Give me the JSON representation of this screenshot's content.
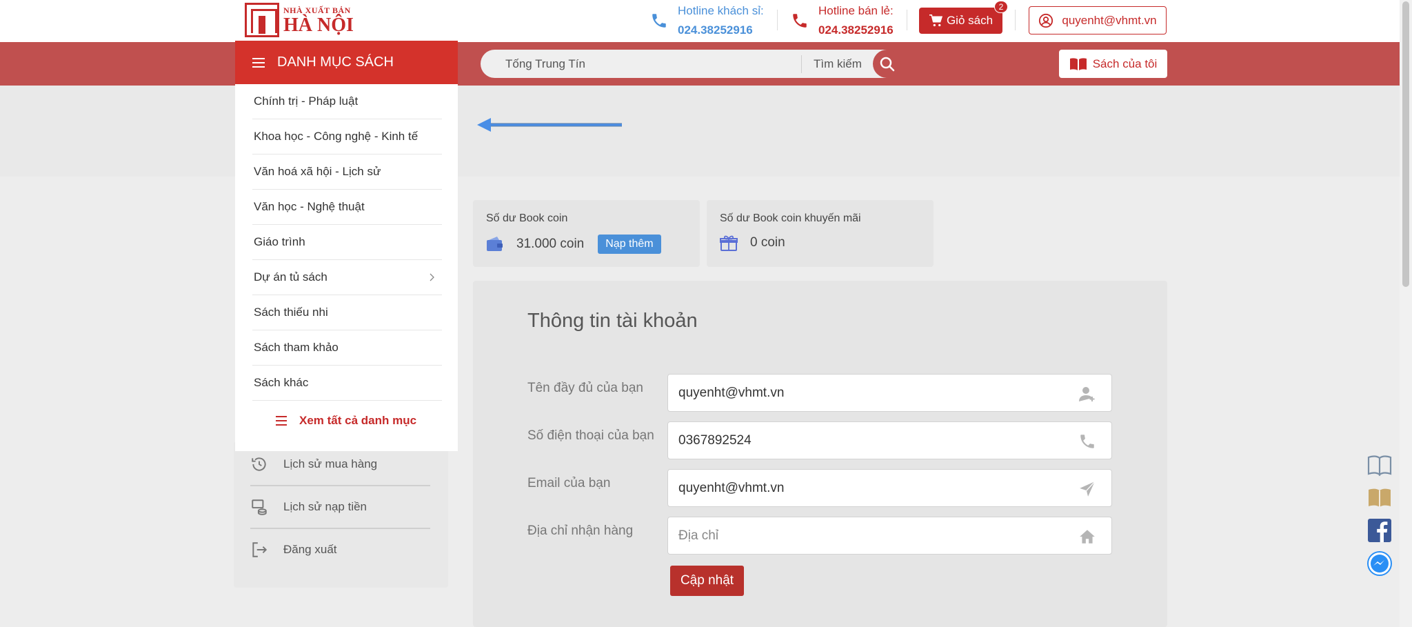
{
  "header": {
    "logo": {
      "small": "NHÀ XUẤT BẢN",
      "big": "HÀ NỘI"
    },
    "hotline_wholesale": {
      "label": "Hotline khách sỉ:",
      "number": "024.38252916"
    },
    "hotline_retail": {
      "label": "Hotline bán lẻ:",
      "number": "024.38252916"
    },
    "cart": {
      "label": "Giỏ sách",
      "count": "2"
    },
    "user": {
      "email": "quyenht@vhmt.vn"
    }
  },
  "navbar": {
    "search": {
      "value": "Tống Trung Tín",
      "button_label": "Tìm kiếm"
    },
    "my_books_label": "Sách của tôi"
  },
  "category_menu": {
    "title": "DANH MỤC SÁCH",
    "items": [
      "Chính trị - Pháp luật",
      "Khoa học - Công nghệ - Kinh tế",
      "Văn hoá xã hội - Lịch sử",
      "Văn học - Nghệ thuật",
      "Giáo trình",
      "Dự án tủ sách",
      "Sách thiếu nhi",
      "Sách tham khảo",
      "Sách khác"
    ],
    "view_all": "Xem tất cả danh mục"
  },
  "sidebar": {
    "items": [
      "Lịch sử mua hàng",
      "Lịch sử nạp tiền",
      "Đăng xuất"
    ]
  },
  "coins": {
    "balance": {
      "label": "Số dư Book coin",
      "value": "31.000 coin",
      "topup_label": "Nạp thêm"
    },
    "promo": {
      "label": "Số dư Book coin khuyến mãi",
      "value": "0 coin"
    }
  },
  "account": {
    "title": "Thông tin tài khoản",
    "fields": [
      {
        "label": "Tên đầy đủ của bạn",
        "value": "quyenht@vhmt.vn",
        "placeholder": ""
      },
      {
        "label": "Số điện thoại của bạn",
        "value": "0367892524",
        "placeholder": ""
      },
      {
        "label": "Email của bạn",
        "value": "quyenht@vhmt.vn",
        "placeholder": ""
      },
      {
        "label": "Địa chỉ nhận hàng",
        "value": "",
        "placeholder": "Địa chỉ"
      }
    ],
    "update_label": "Cập nhật"
  },
  "colors": {
    "brand_red": "#c62a2a",
    "navbar_red": "#c0504f",
    "menu_header_red": "#d4322b",
    "link_blue": "#4a90d9"
  },
  "icons": [
    "phone-icon",
    "cart-icon",
    "user-circle-icon",
    "search-icon",
    "book-icon",
    "hamburger-icon",
    "chevron-right-icon",
    "history-icon",
    "topup-history-icon",
    "logout-icon",
    "wallet-icon",
    "gift-icon",
    "add-user-icon",
    "send-icon",
    "home-icon",
    "facebook-icon",
    "messenger-icon"
  ]
}
